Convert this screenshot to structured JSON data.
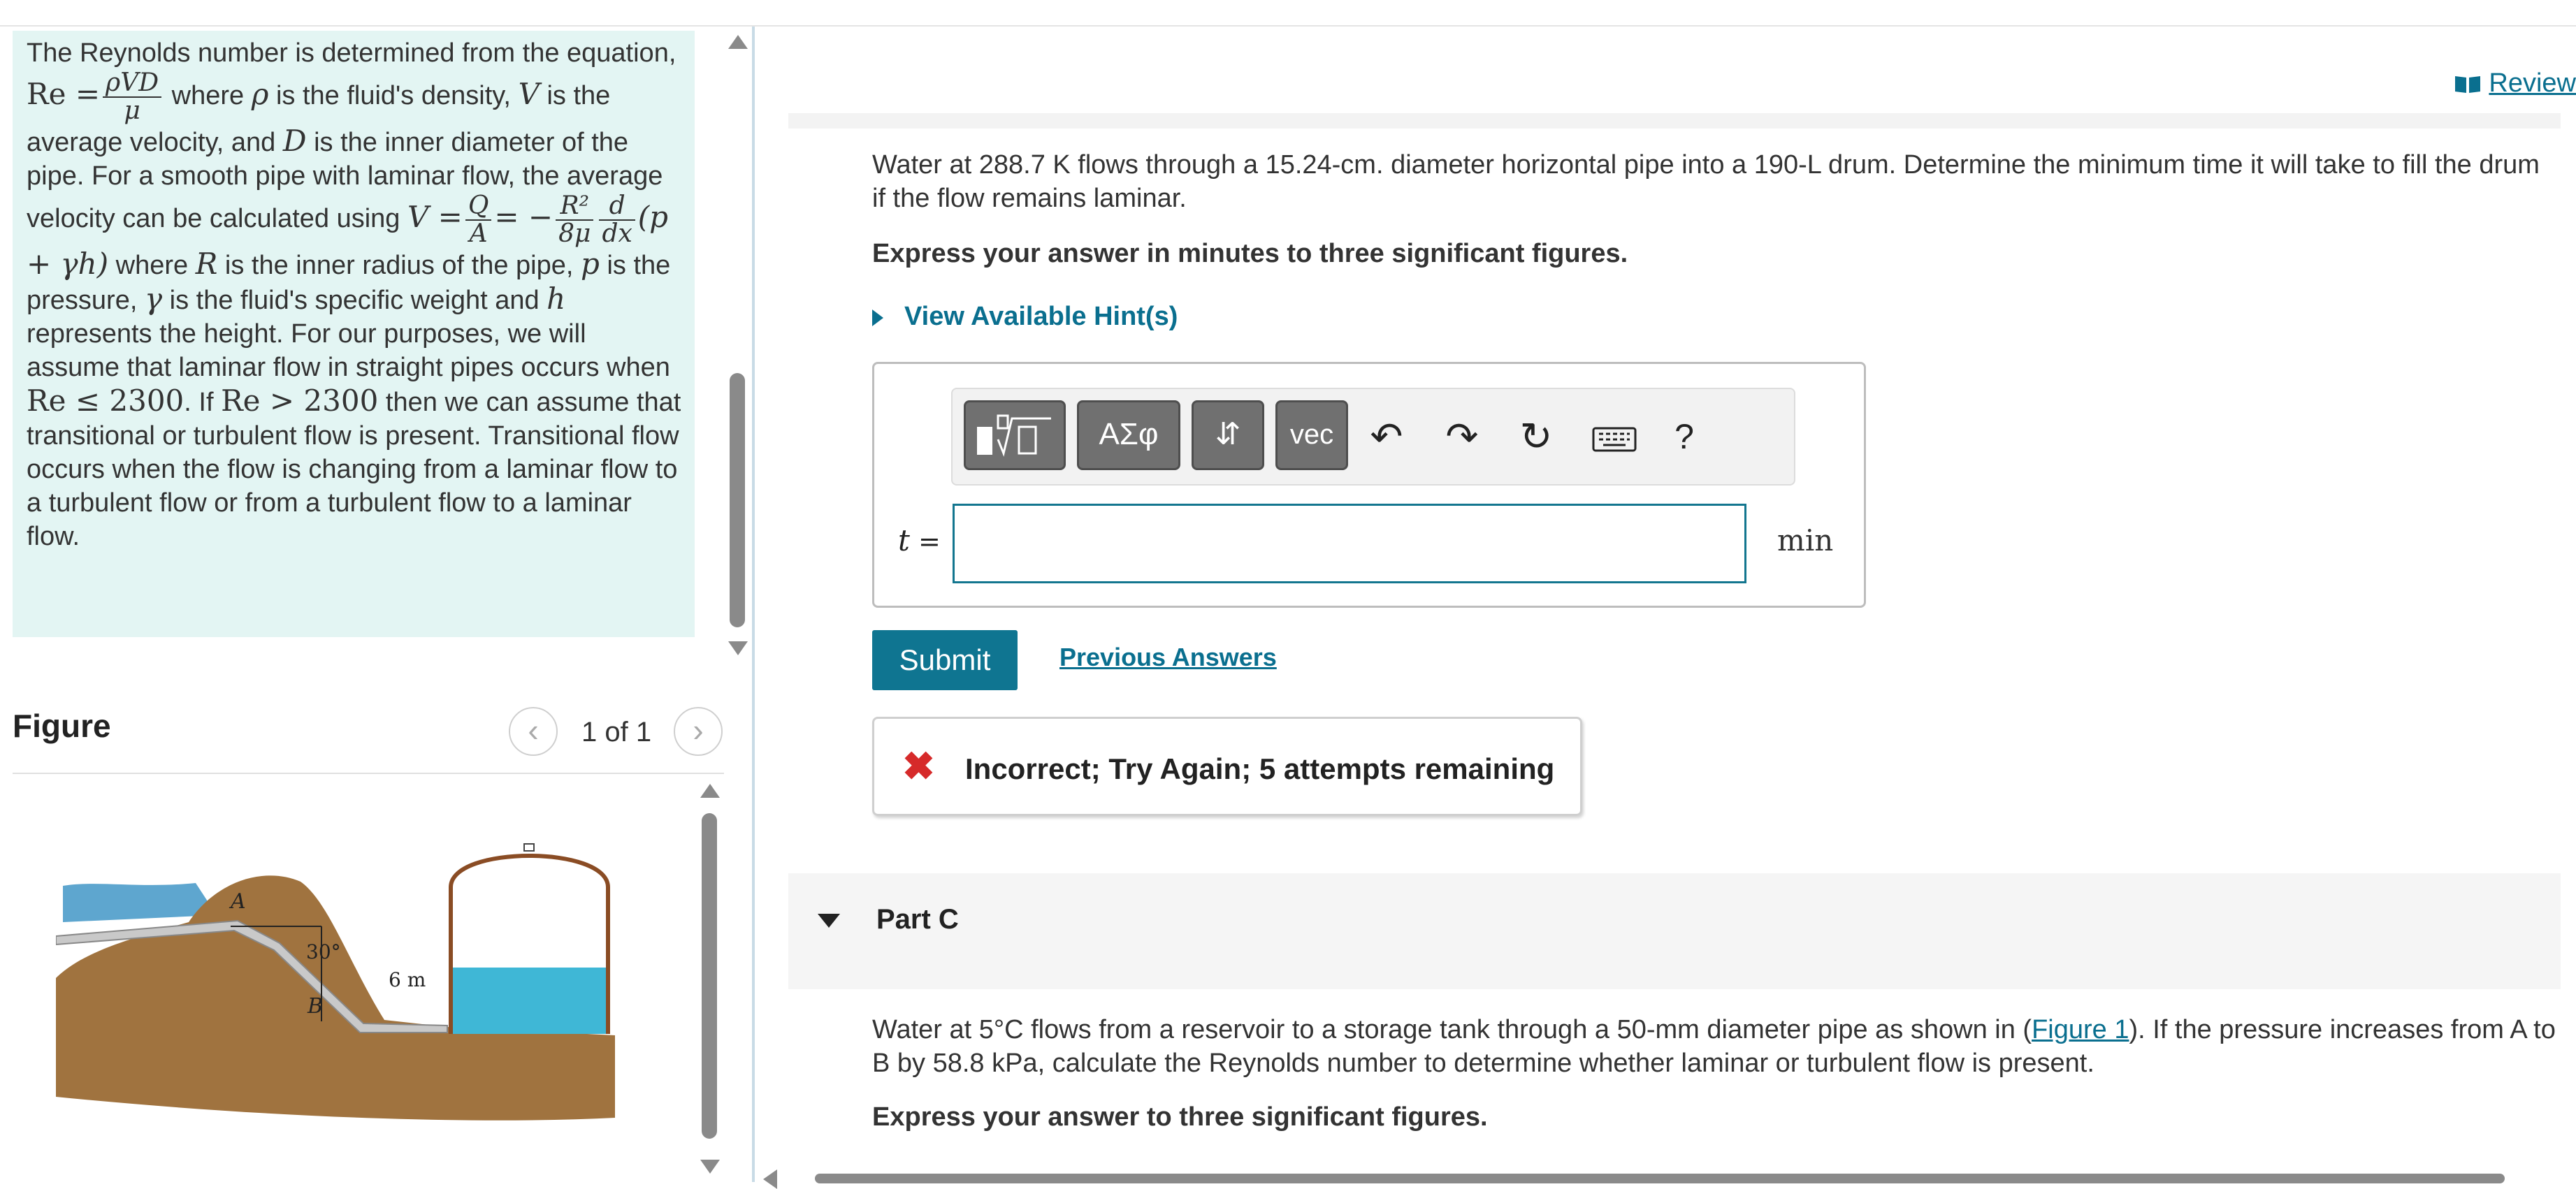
{
  "intro": {
    "s1": "The Reynolds number is determined from the equation, ",
    "re": "Re =",
    "re_num": "ρVD",
    "re_den": "μ",
    "s2": " where ",
    "rho": "ρ",
    "s3": " is the fluid's density, ",
    "V": "V",
    "s4": " is the average velocity, and ",
    "D": "D",
    "s5": " is the inner diameter of the pipe. For a smooth pipe with laminar flow, the average velocity can be calculated using ",
    "v_eq": "V =",
    "q_num": "Q",
    "q_den": "A",
    "eq_mid": "= −",
    "r_num": "R²",
    "r_den": "8μ",
    "d_num": "d",
    "d_den": "dx",
    "paren": "(p + γh)",
    "s6": " where ",
    "R": "R",
    "s7": " is the inner radius of the pipe, ",
    "p": "p",
    "s8": " is the pressure, ",
    "gamma": "γ",
    "s9": " is the fluid's specific weight and ",
    "h": "h",
    "s10": " represents the height. For our purposes, we will assume that laminar flow in straight pipes occurs when ",
    "cond1": "Re ≤ 2300",
    "s11": ". If ",
    "cond2": "Re > 2300",
    "s12": " then we can assume that transitional or turbulent flow is present.  Transitional flow occurs when the flow is changing from a laminar flow to a turbulent flow or from a turbulent flow to a laminar flow."
  },
  "figure": {
    "title": "Figure",
    "count": "1 of 1",
    "prev_icon": "chevron-left-icon",
    "next_icon": "chevron-right-icon",
    "label_a": "A",
    "label_b": "B",
    "angle": "30°",
    "height": "6 m"
  },
  "review": {
    "label": "Review",
    "icon": "book-icon"
  },
  "partB": {
    "question": "Water at 288.7 K flows through a 15.24-cm. diameter horizontal pipe into a 190-L drum. Determine the minimum time it will take to fill the drum if the flow remains laminar.",
    "express": "Express your answer in minutes to three significant figures.",
    "hint": "View Available Hint(s)",
    "toolbar": {
      "greek": "ΑΣφ",
      "arrows": "⇵",
      "vec": "vec",
      "help": "?"
    },
    "var": "t",
    "equals": "=",
    "input_value": "",
    "unit": "min",
    "submit": "Submit",
    "previous": "Previous Answers",
    "feedback": "Incorrect; Try Again; 5 attempts remaining"
  },
  "partC": {
    "label": "Part C",
    "q_pre": "Water at 5°C flows from a reservoir to a storage tank through a 50-mm diameter pipe as shown in (",
    "q_link": "Figure 1",
    "q_post": "). If the pressure increases from A to B by 58.8 kPa, calculate the Reynolds number to determine whether laminar or turbulent flow is present.",
    "express": "Express your answer to three significant figures."
  },
  "colors": {
    "accent": "#0f7591",
    "link": "#0a6f8f",
    "error": "#d62a2a",
    "intro_bg": "#e3f5f3"
  }
}
